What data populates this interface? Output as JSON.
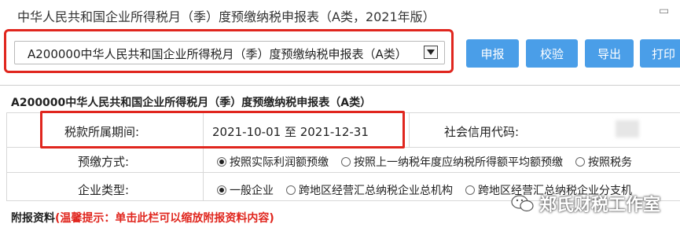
{
  "header": {
    "title": "中华人民共和国企业所得税月（季）度预缴纳税申报表（A类，2021年版）",
    "corner_icon": "collapse-icon"
  },
  "selector": {
    "value": "A200000中华人民共和国企业所得税月（季）度预缴纳税申报表（A类）"
  },
  "toolbar": {
    "declare_label": "申报",
    "verify_label": "校验",
    "export_label": "导出",
    "print_label": "打印"
  },
  "form": {
    "title": "A200000中华人民共和国企业所得税月（季）度预缴纳税申报表（A类）",
    "period_label": "税款所属期间:",
    "period_value": "2021-10-01 至 2021-12-31",
    "credit_code_label": "社会信用代码:",
    "prepay_label": "预缴方式:",
    "prepay_options": [
      {
        "label": "按照实际利润额预缴",
        "checked": true
      },
      {
        "label": "按照上一纳税年度应纳税所得额平均额预缴",
        "checked": false
      },
      {
        "label": "按照税务",
        "checked": false
      }
    ],
    "enterprise_label": "企业类型:",
    "enterprise_options": [
      {
        "label": "一般企业",
        "checked": true
      },
      {
        "label": "跨地区经营汇总纳税企业总机构",
        "checked": false
      },
      {
        "label": "跨地区经营汇总纳税企业分支机",
        "checked": false
      }
    ],
    "attach_label": "附报资料",
    "attach_hint": "(温馨提示：单击此栏可以缩放附报资料内容)"
  },
  "watermark": {
    "text": "郑氏财税工作室",
    "icon": "wechat-icon"
  },
  "colors": {
    "button": "#4a9ee8",
    "highlight": "#e0261e"
  }
}
